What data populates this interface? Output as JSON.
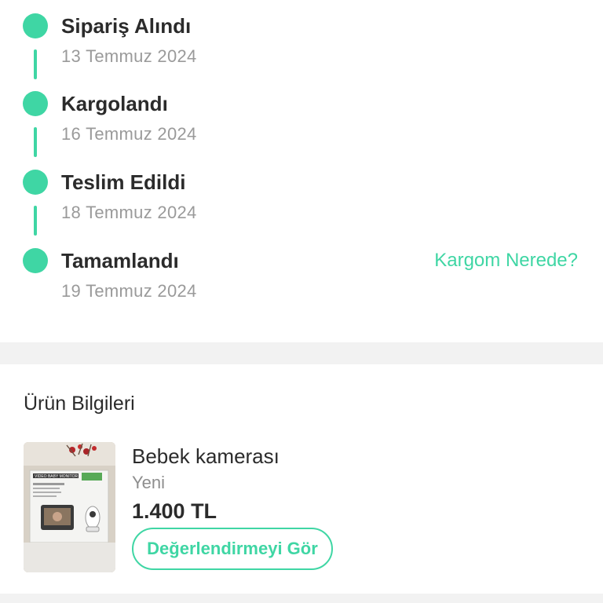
{
  "timeline": {
    "steps": [
      {
        "title": "Sipariş Alındı",
        "date": "13 Temmuz 2024"
      },
      {
        "title": "Kargolandı",
        "date": "16 Temmuz 2024"
      },
      {
        "title": "Teslim Edildi",
        "date": "18 Temmuz 2024"
      },
      {
        "title": "Tamamlandı",
        "date": "19 Temmuz 2024"
      }
    ],
    "track_link": "Kargom Nerede?"
  },
  "product_section": {
    "title": "Ürün Bilgileri",
    "product": {
      "name": "Bebek kamerası",
      "condition": "Yeni",
      "price": "1.400 TL",
      "review_button": "Değerlendirmeyi Gör",
      "thumbnail_box_text": "VIDEO BABY MONITOR"
    }
  },
  "colors": {
    "accent": "#3fd6a4",
    "text": "#2b2b2b",
    "muted": "#9a9a9a",
    "divider": "#f2f2f2"
  }
}
